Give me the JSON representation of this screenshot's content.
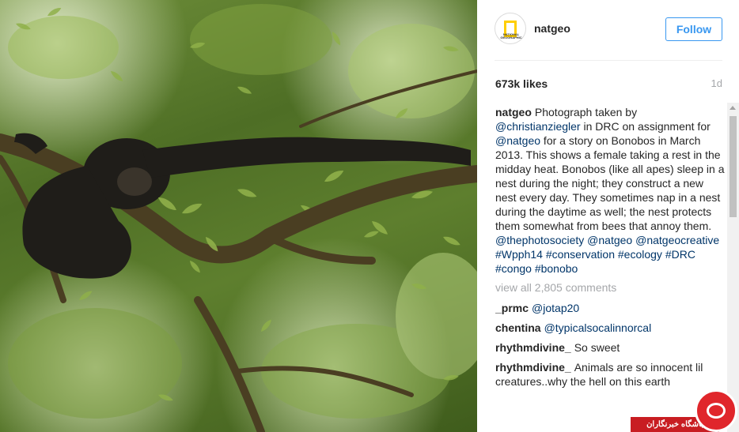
{
  "post": {
    "photo_alt": "photo",
    "username": "natgeo",
    "avatar_text": "NATIONAL GEOGRAPHIC",
    "follow_label": "Follow",
    "likes": "673k likes",
    "age": "1d",
    "caption": {
      "user": "natgeo",
      "parts": [
        {
          "text": "Photograph taken by ",
          "mention": false
        },
        {
          "text": "@christianziegler",
          "mention": true
        },
        {
          "text": " in DRC on assignment for ",
          "mention": false
        },
        {
          "text": "@natgeo",
          "mention": true
        },
        {
          "text": " for a story on Bonobos in March 2013. This shows a female taking a rest in the midday heat. Bonobos (like all apes) sleep in a nest during the night; they construct a new nest every day. They sometimes nap in a nest during the daytime as well; the nest protects them somewhat from bees that annoy them. ",
          "mention": false
        },
        {
          "text": "@thephotosociety",
          "mention": true
        },
        {
          "text": " ",
          "mention": false
        },
        {
          "text": "@natgeo",
          "mention": true
        },
        {
          "text": " ",
          "mention": false
        },
        {
          "text": "@natgeocreative",
          "mention": true
        },
        {
          "text": " ",
          "mention": false
        },
        {
          "text": "#Wpph14",
          "mention": true
        },
        {
          "text": " ",
          "mention": false
        },
        {
          "text": "#conservation",
          "mention": true
        },
        {
          "text": " ",
          "mention": false
        },
        {
          "text": "#ecology",
          "mention": true
        },
        {
          "text": " ",
          "mention": false
        },
        {
          "text": "#DRC",
          "mention": true
        },
        {
          "text": " ",
          "mention": false
        },
        {
          "text": "#congo",
          "mention": true
        },
        {
          "text": " ",
          "mention": false
        },
        {
          "text": "#bonobo",
          "mention": true
        }
      ]
    },
    "view_all": "view all 2,805 comments",
    "comments": [
      {
        "user": "_prmc",
        "text": "@jotap20",
        "mention": true
      },
      {
        "user": "chentina",
        "text": "@typicalsocalinnorcal",
        "mention": true
      },
      {
        "user": "rhythmdivine_",
        "text": "So sweet",
        "mention": false
      },
      {
        "user": "rhythmdivine_",
        "text": "Animals are so innocent lil creatures..why the hell on this earth",
        "mention": false
      }
    ]
  },
  "watermark": {
    "label": "باشگاه خبرنگاران"
  },
  "colors": {
    "link": "#003569",
    "follow": "#3897f0",
    "muted": "#a5a7aa"
  }
}
